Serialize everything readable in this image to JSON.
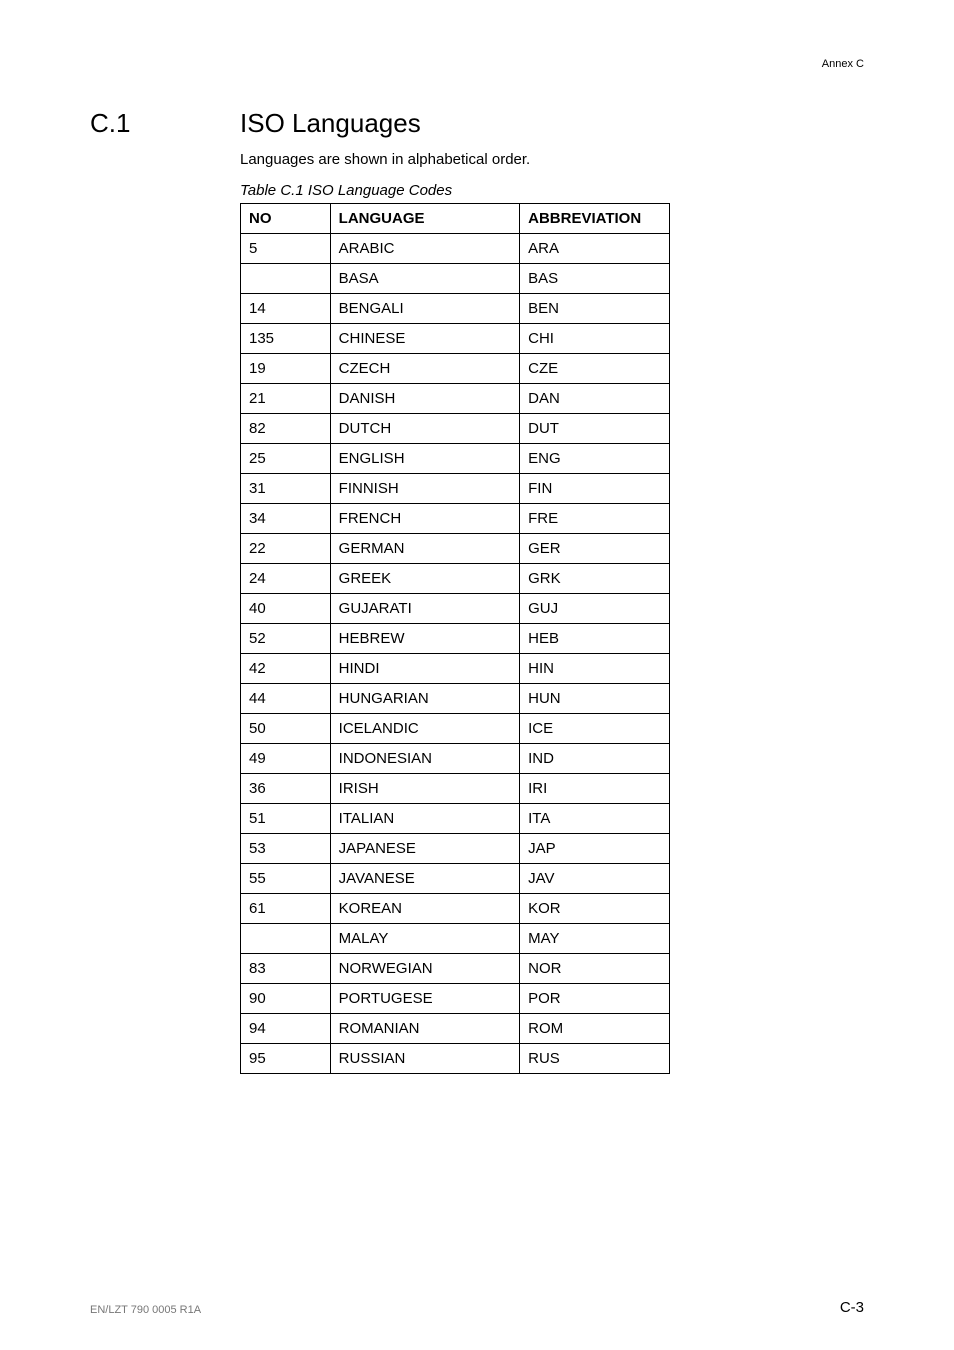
{
  "header": {
    "annex": "Annex C"
  },
  "section": {
    "number": "C.1",
    "title": "ISO Languages"
  },
  "intro": "Languages are shown in alphabetical order.",
  "table": {
    "caption": "Table C.1   ISO Language Codes",
    "headers": {
      "no": "NO",
      "language": "LANGUAGE",
      "abbreviation": "ABBREVIATION"
    },
    "rows": [
      {
        "no": "5",
        "language": "ARABIC",
        "abbreviation": "ARA"
      },
      {
        "no": "",
        "language": "BASA",
        "abbreviation": "BAS"
      },
      {
        "no": "14",
        "language": "BENGALI",
        "abbreviation": "BEN"
      },
      {
        "no": "135",
        "language": "CHINESE",
        "abbreviation": "CHI"
      },
      {
        "no": "19",
        "language": "CZECH",
        "abbreviation": "CZE"
      },
      {
        "no": "21",
        "language": "DANISH",
        "abbreviation": "DAN"
      },
      {
        "no": "82",
        "language": "DUTCH",
        "abbreviation": "DUT"
      },
      {
        "no": "25",
        "language": "ENGLISH",
        "abbreviation": "ENG"
      },
      {
        "no": "31",
        "language": "FINNISH",
        "abbreviation": "FIN"
      },
      {
        "no": "34",
        "language": "FRENCH",
        "abbreviation": "FRE"
      },
      {
        "no": "22",
        "language": "GERMAN",
        "abbreviation": "GER"
      },
      {
        "no": "24",
        "language": "GREEK",
        "abbreviation": "GRK"
      },
      {
        "no": "40",
        "language": "GUJARATI",
        "abbreviation": "GUJ"
      },
      {
        "no": "52",
        "language": "HEBREW",
        "abbreviation": "HEB"
      },
      {
        "no": "42",
        "language": "HINDI",
        "abbreviation": "HIN"
      },
      {
        "no": "44",
        "language": "HUNGARIAN",
        "abbreviation": "HUN"
      },
      {
        "no": "50",
        "language": "ICELANDIC",
        "abbreviation": "ICE"
      },
      {
        "no": "49",
        "language": "INDONESIAN",
        "abbreviation": "IND"
      },
      {
        "no": "36",
        "language": "IRISH",
        "abbreviation": "IRI"
      },
      {
        "no": "51",
        "language": "ITALIAN",
        "abbreviation": "ITA"
      },
      {
        "no": "53",
        "language": "JAPANESE",
        "abbreviation": "JAP"
      },
      {
        "no": "55",
        "language": "JAVANESE",
        "abbreviation": "JAV"
      },
      {
        "no": "61",
        "language": "KOREAN",
        "abbreviation": "KOR"
      },
      {
        "no": "",
        "language": "MALAY",
        "abbreviation": "MAY"
      },
      {
        "no": "83",
        "language": "NORWEGIAN",
        "abbreviation": "NOR"
      },
      {
        "no": "90",
        "language": "PORTUGESE",
        "abbreviation": "POR"
      },
      {
        "no": "94",
        "language": "ROMANIAN",
        "abbreviation": "ROM"
      },
      {
        "no": "95",
        "language": "RUSSIAN",
        "abbreviation": "RUS"
      }
    ]
  },
  "footer": {
    "left": "EN/LZT 790 0005 R1A",
    "right": "C-3"
  }
}
